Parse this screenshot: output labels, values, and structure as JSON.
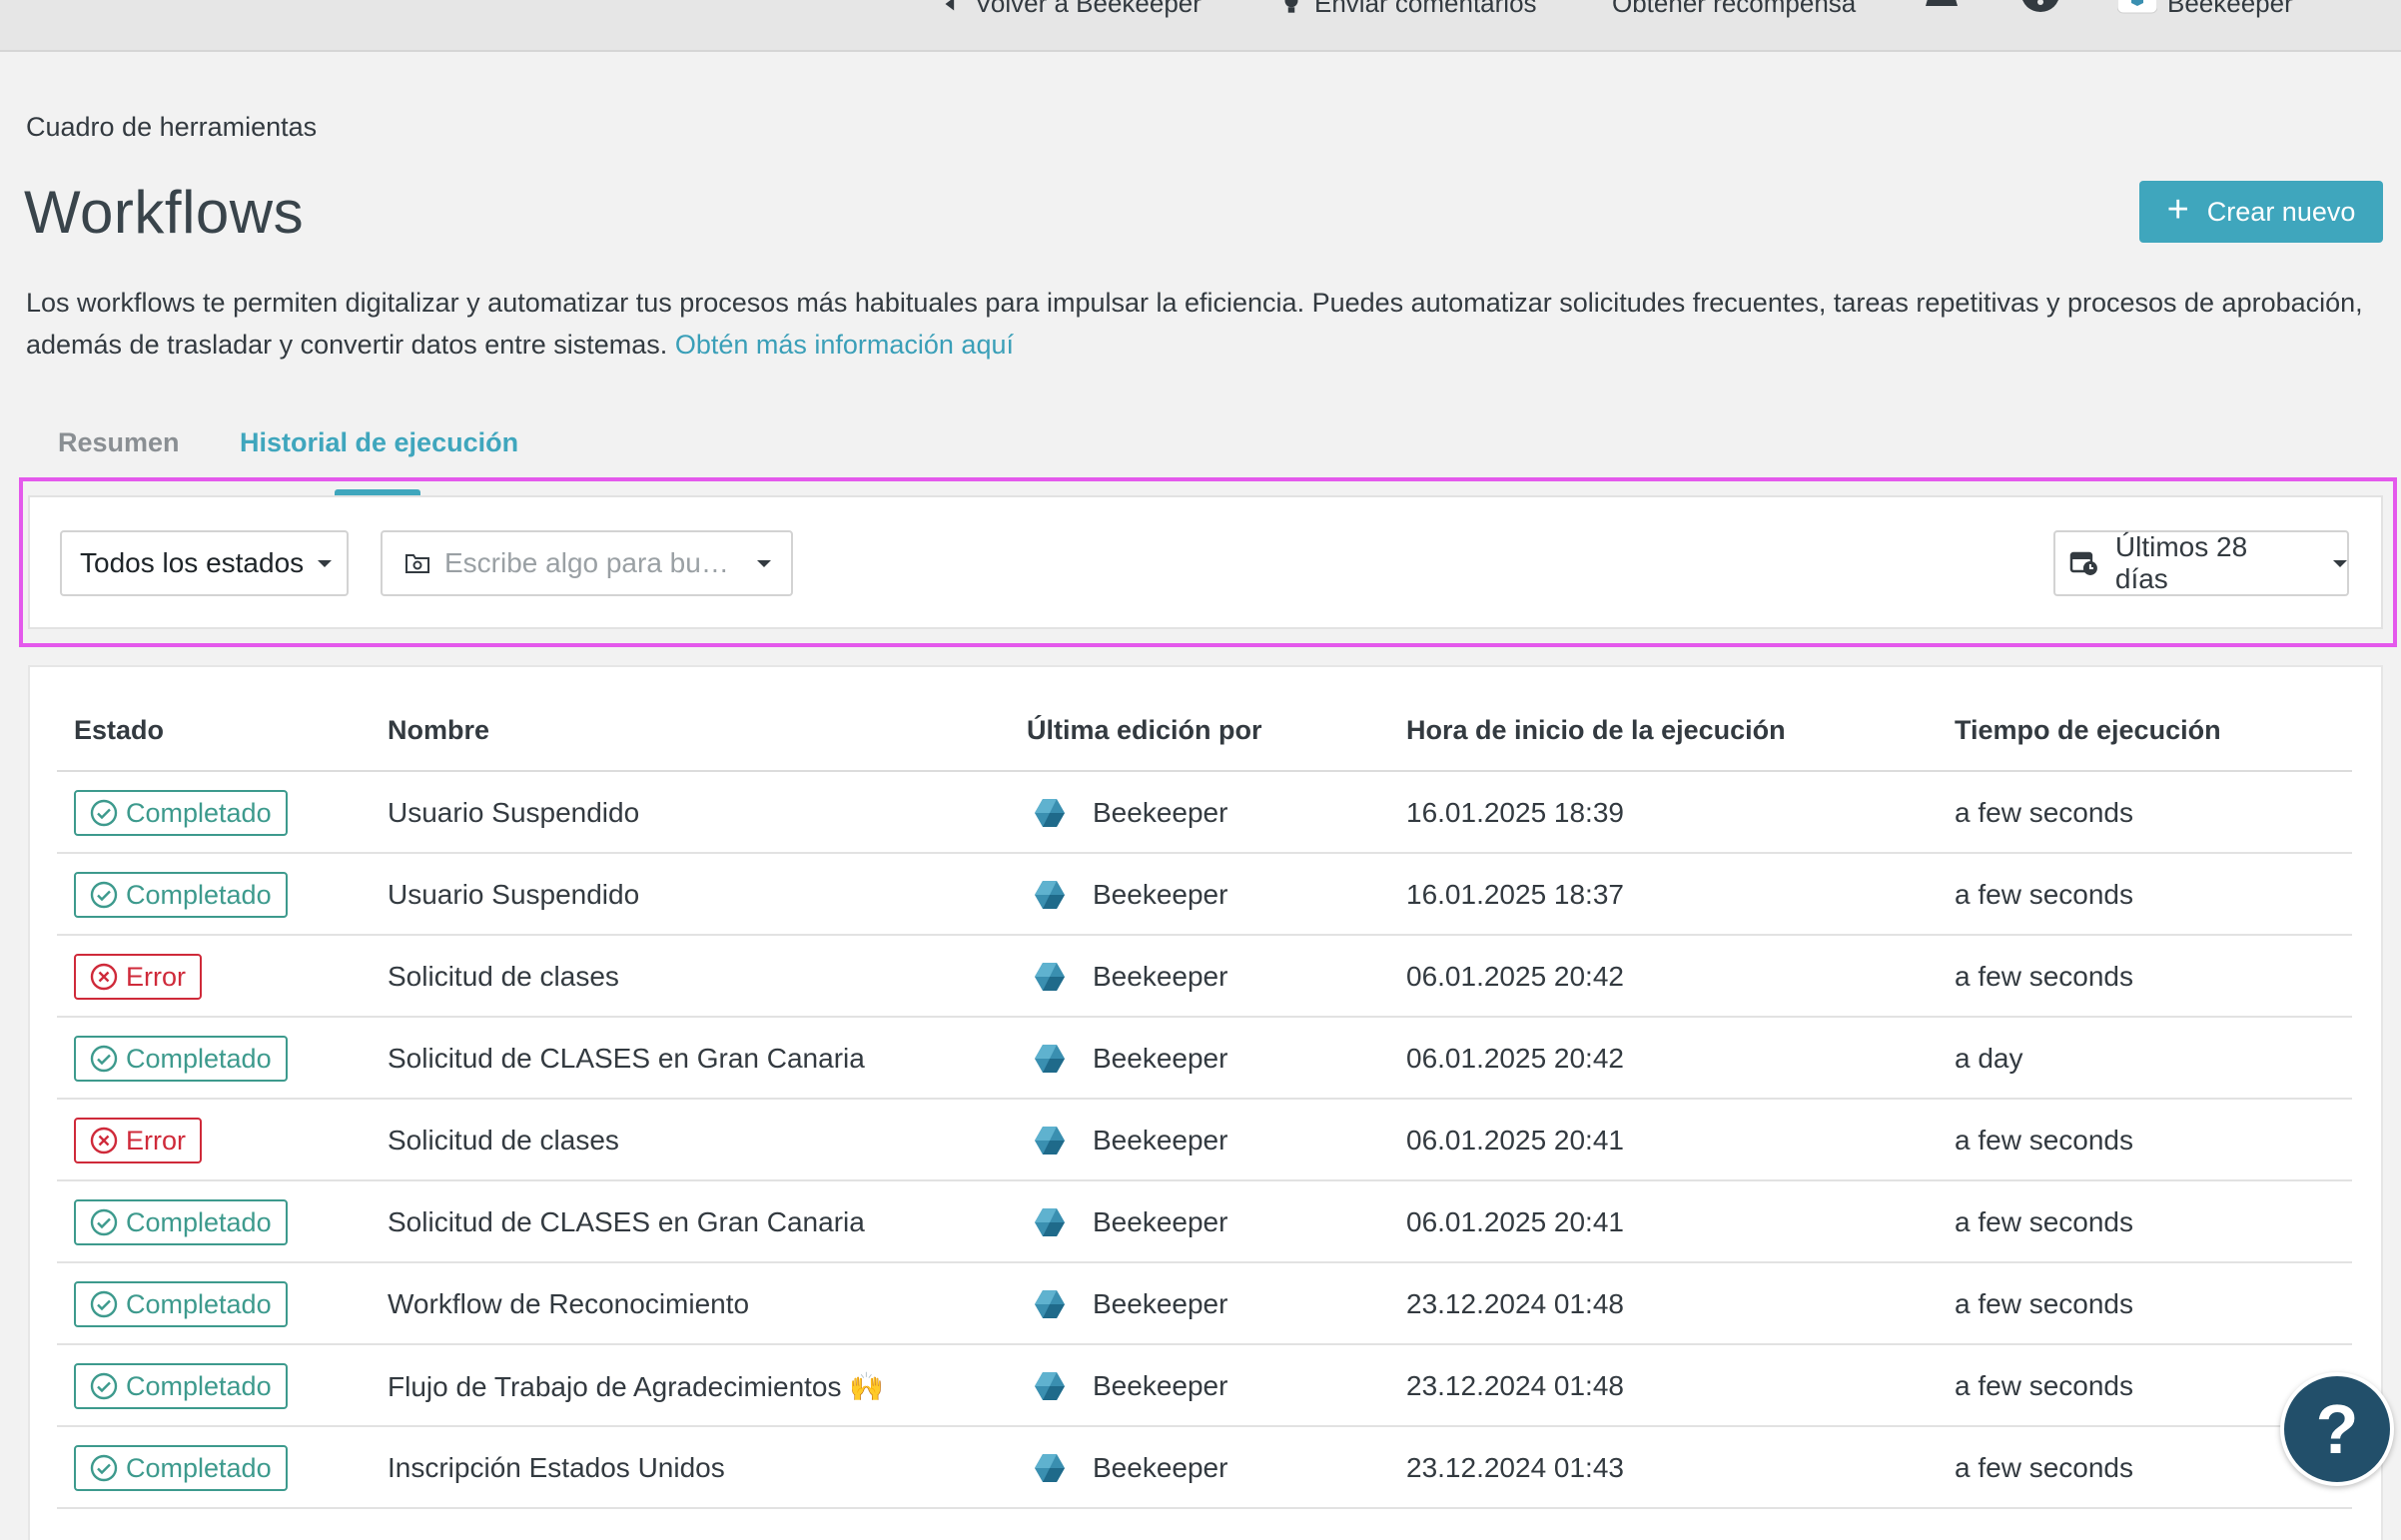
{
  "topbar": {
    "back_label": "Volver a Beekeeper",
    "feedback_label": "Enviar comentarios",
    "reward_label": "Obtener recompensa",
    "account_label": "Beekeeper"
  },
  "breadcrumb": "Cuadro de herramientas",
  "page_title": "Workflows",
  "create_button_label": "Crear nuevo",
  "description": {
    "text": "Los workflows te permiten digitalizar y automatizar tus procesos más habituales para impulsar la eficiencia. Puedes automatizar solicitudes frecuentes, tareas repetitivas y procesos de aprobación, además de trasladar y convertir datos entre sistemas.",
    "link": "Obtén más información aquí"
  },
  "tabs": [
    {
      "label": "Resumen",
      "active": false
    },
    {
      "label": "Historial de ejecución",
      "active": true
    }
  ],
  "filters": {
    "status_value": "Todos los estados",
    "search_placeholder": "Escribe algo para bu…",
    "date_range": "Últimos 28 días"
  },
  "table": {
    "columns": [
      "Estado",
      "Nombre",
      "Última edición por",
      "Hora de inicio de la ejecución",
      "Tiempo de ejecución"
    ],
    "rows": [
      {
        "status": "Completado",
        "name": "Usuario Suspendido",
        "editor": "Beekeeper",
        "start": "16.01.2025 18:39",
        "duration": "a few seconds"
      },
      {
        "status": "Completado",
        "name": "Usuario Suspendido",
        "editor": "Beekeeper",
        "start": "16.01.2025 18:37",
        "duration": "a few seconds"
      },
      {
        "status": "Error",
        "name": "Solicitud de clases",
        "editor": "Beekeeper",
        "start": "06.01.2025 20:42",
        "duration": "a few seconds"
      },
      {
        "status": "Completado",
        "name": "Solicitud de CLASES en Gran Canaria",
        "editor": "Beekeeper",
        "start": "06.01.2025 20:42",
        "duration": "a day"
      },
      {
        "status": "Error",
        "name": "Solicitud de clases",
        "editor": "Beekeeper",
        "start": "06.01.2025 20:41",
        "duration": "a few seconds"
      },
      {
        "status": "Completado",
        "name": "Solicitud de CLASES en Gran Canaria",
        "editor": "Beekeeper",
        "start": "06.01.2025 20:41",
        "duration": "a few seconds"
      },
      {
        "status": "Completado",
        "name": "Workflow de Reconocimiento",
        "editor": "Beekeeper",
        "start": "23.12.2024 01:48",
        "duration": "a few seconds"
      },
      {
        "status": "Completado",
        "name": "Flujo de Trabajo de Agradecimientos 🙌",
        "editor": "Beekeeper",
        "start": "23.12.2024 01:48",
        "duration": "a few seconds"
      },
      {
        "status": "Completado",
        "name": "Inscripción Estados Unidos",
        "editor": "Beekeeper",
        "start": "23.12.2024 01:43",
        "duration": "a few seconds"
      }
    ]
  },
  "help_label": "?",
  "colors": {
    "accent": "#3fa6bd",
    "success": "#3d9a8d",
    "error": "#cf2a3a",
    "highlight": "#e459ec"
  }
}
